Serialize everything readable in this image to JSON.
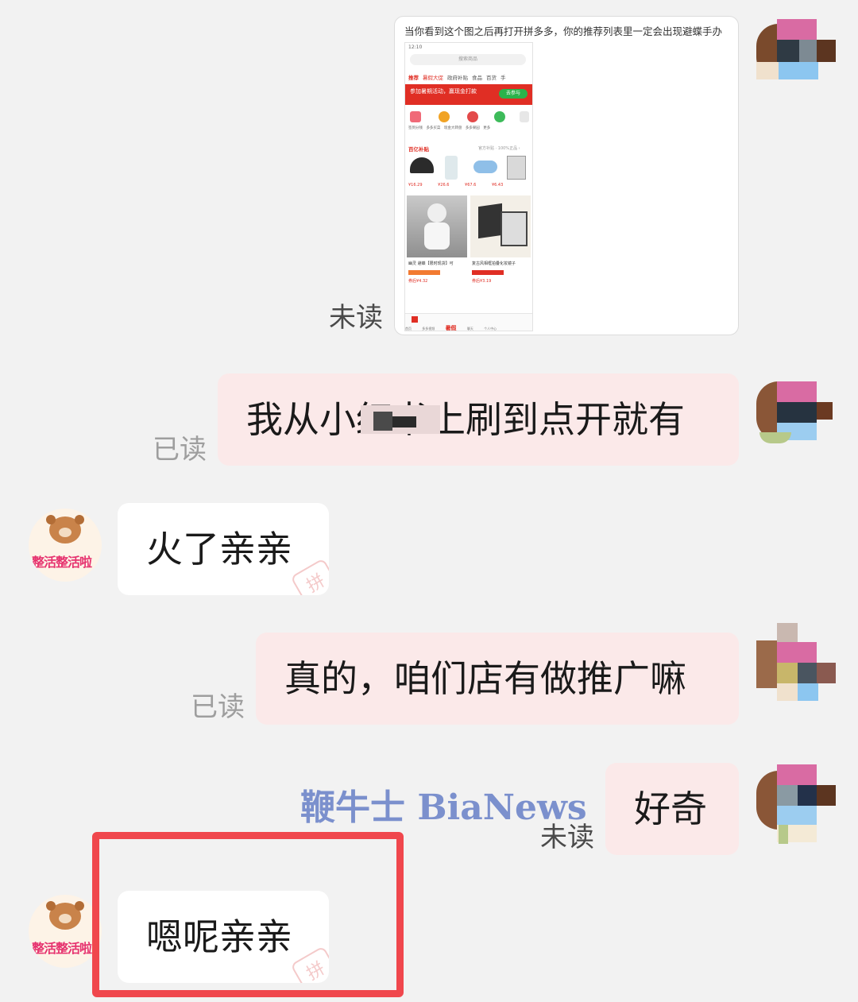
{
  "image_message": {
    "caption": "当你看到这个图之后再打开拼多多，你的推荐列表里一定会出现避蝶手办",
    "status": "未读",
    "phone": {
      "time": "12:10",
      "search_placeholder": "搜索商品",
      "tabs": [
        "推荐",
        "暑假大促",
        "政府补贴",
        "食品",
        "百货",
        "手"
      ],
      "banner_left": "参加暑期活动，赢现金打款",
      "banner_button": "去参与",
      "quick_icons": [
        "签到分钱",
        "多多买菜",
        "现金大转盘",
        "多多果园",
        "更多"
      ],
      "section_title": "百亿补贴",
      "section_right": "官方补贴 · 100%正品 ›",
      "products": [
        "¥16.29",
        "¥26.6",
        "¥67.6",
        "¥6.43"
      ],
      "cards": [
        {
          "title": "幽灵 避蝶【限时现货】可",
          "price": "券后¥4.32"
        },
        {
          "title": "复古风相框拍叠化妆镜子",
          "price": "券后¥3.19"
        }
      ],
      "bottom_nav": [
        "首页",
        "多多视频",
        "暑假",
        "聊天",
        "个人中心"
      ]
    }
  },
  "messages": [
    {
      "id": "m1",
      "text": "我从小红书上刷到点开就有",
      "status": "已读"
    },
    {
      "id": "m2",
      "text": "火了亲亲"
    },
    {
      "id": "m3",
      "text": "真的，咱们店有做推广嘛",
      "status": "已读"
    },
    {
      "id": "m4",
      "text": "好奇",
      "status": "未读"
    },
    {
      "id": "m5",
      "text": "嗯呢亲亲"
    }
  ],
  "shop": {
    "name": "整活整活啦",
    "stamp": "拼"
  },
  "watermark": "鞭牛士 BiaNews",
  "colors": {
    "outgoing_bubble": "#fbe9e9",
    "incoming_bubble": "#ffffff",
    "background": "#f2f2f2",
    "highlight": "#f0474d",
    "pdd_red": "#e02e24"
  }
}
